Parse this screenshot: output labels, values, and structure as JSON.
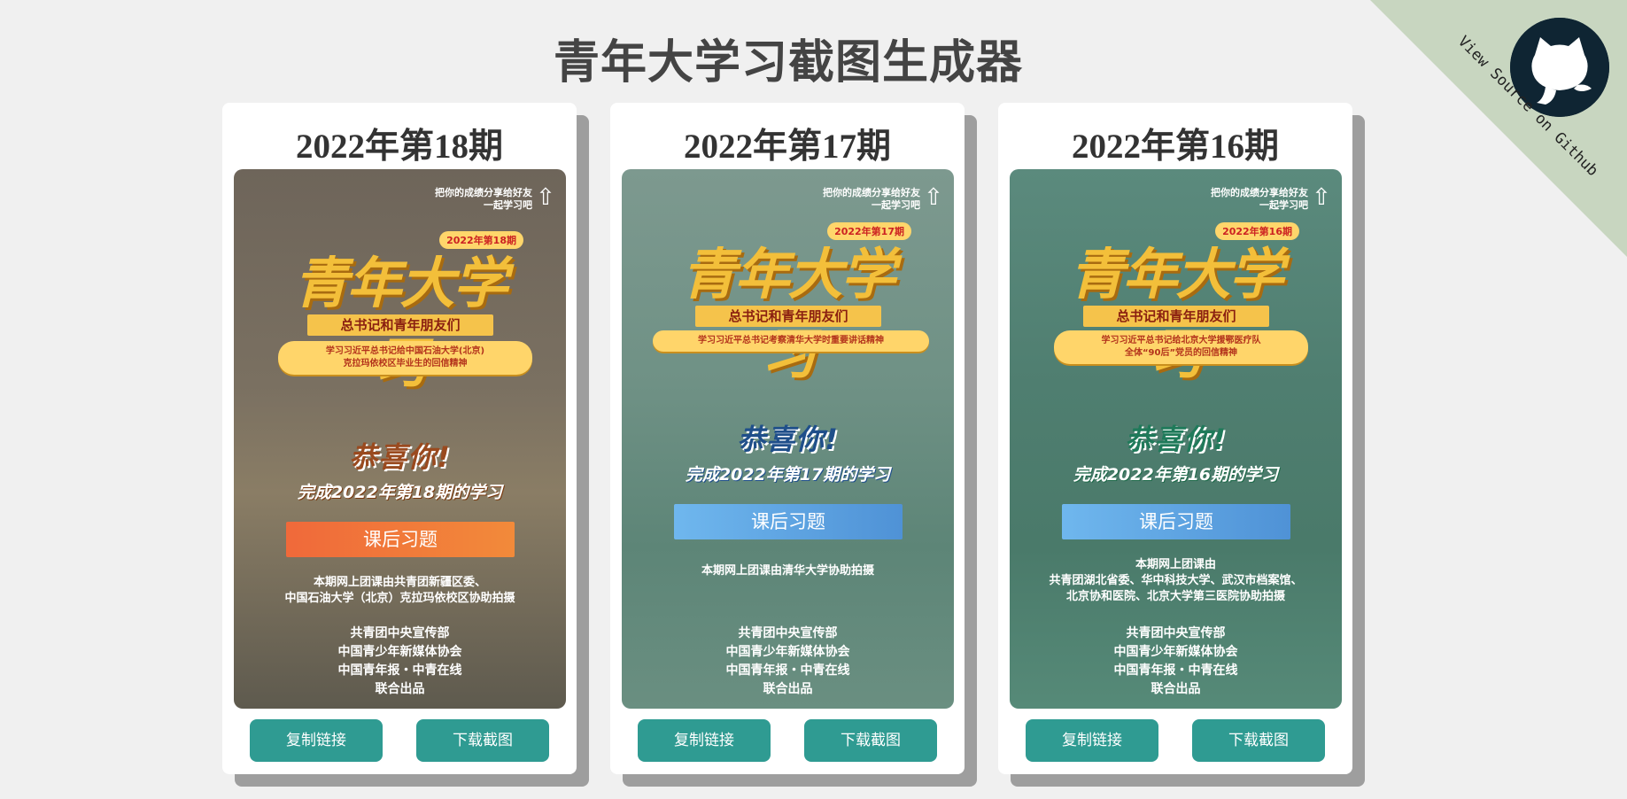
{
  "page": {
    "title": "青年大学习截图生成器"
  },
  "github": {
    "label": "View Source on Github"
  },
  "cards": [
    {
      "title": "2022年第18期",
      "poster": {
        "share_line1": "把你的成绩分享给好友",
        "share_line2": "一起学习吧",
        "logo": "青年大学习",
        "issue_tag": "2022年第18期",
        "subtitle": "总书记和青年朋友们",
        "topic_line1": "学习习近平总书记给中国石油大学(北京)",
        "topic_line2": "克拉玛依校区毕业生的回信精神",
        "congrats": "恭喜你!",
        "complete": "完成2022年第18期的学习",
        "exercise": "课后习题",
        "credit_lines": [
          "本期网上团课由共青团新疆区委、",
          "中国石油大学（北京）克拉玛依校区协助拍摄"
        ],
        "org_lines": [
          "共青团中央宣传部",
          "中国青少年新媒体协会",
          "中国青年报・中青在线",
          "联合出品"
        ]
      },
      "copy_label": "复制链接",
      "download_label": "下载截图"
    },
    {
      "title": "2022年第17期",
      "poster": {
        "share_line1": "把你的成绩分享给好友",
        "share_line2": "一起学习吧",
        "logo": "青年大学习",
        "issue_tag": "2022年第17期",
        "subtitle": "总书记和青年朋友们",
        "topic_line1": "学习习近平总书记考察清华大学时重要讲话精神",
        "topic_line2": "",
        "congrats": "恭喜你!",
        "complete": "完成2022年第17期的学习",
        "exercise": "课后习题",
        "credit_lines": [
          "本期网上团课由清华大学协助拍摄"
        ],
        "org_lines": [
          "共青团中央宣传部",
          "中国青少年新媒体协会",
          "中国青年报・中青在线",
          "联合出品"
        ]
      },
      "copy_label": "复制链接",
      "download_label": "下载截图"
    },
    {
      "title": "2022年第16期",
      "poster": {
        "share_line1": "把你的成绩分享给好友",
        "share_line2": "一起学习吧",
        "logo": "青年大学习",
        "issue_tag": "2022年第16期",
        "subtitle": "总书记和青年朋友们",
        "topic_line1": "学习习近平总书记给北京大学援鄂医疗队",
        "topic_line2": "全体“90后”党员的回信精神",
        "congrats": "恭喜你!",
        "complete": "完成2022年第16期的学习",
        "exercise": "课后习题",
        "credit_lines": [
          "本期网上团课由",
          "共青团湖北省委、华中科技大学、武汉市档案馆、",
          "北京协和医院、北京大学第三医院协助拍摄"
        ],
        "org_lines": [
          "共青团中央宣传部",
          "中国青少年新媒体协会",
          "中国青年报・中青在线",
          "联合出品"
        ]
      },
      "copy_label": "复制链接",
      "download_label": "下载截图"
    }
  ],
  "colors": {
    "accent": "#2f9b92",
    "exercise_orange": "#f0693a",
    "exercise_blue": "#5ca7e6",
    "congrats_brown": "#9a4a1f",
    "congrats_blue": "#1f4f8a",
    "congrats_green": "#1f7a5a"
  }
}
